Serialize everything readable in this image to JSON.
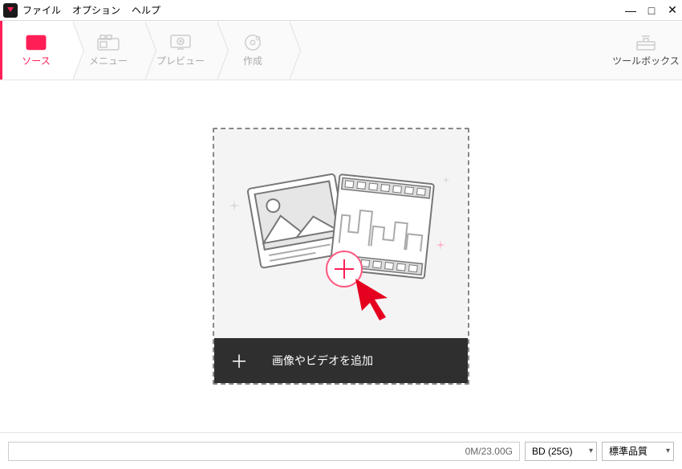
{
  "menu": {
    "file": "ファイル",
    "option": "オプション",
    "help": "ヘルプ"
  },
  "steps": {
    "source": {
      "label": "ソース",
      "active": true
    },
    "menu": {
      "label": "メニュー"
    },
    "preview": {
      "label": "プレビュー"
    },
    "create": {
      "label": "作成"
    }
  },
  "toolbox": {
    "label": "ツールボックス"
  },
  "dropzone": {
    "add_label": "画像やビデオを追加",
    "plus_symbol": "＋"
  },
  "footer": {
    "progress_text": "0M/23.00G",
    "disc_select": "BD (25G)",
    "quality_select": "標準品質"
  },
  "window_controls": {
    "minimize": "—",
    "maximize": "□",
    "close": "✕"
  }
}
